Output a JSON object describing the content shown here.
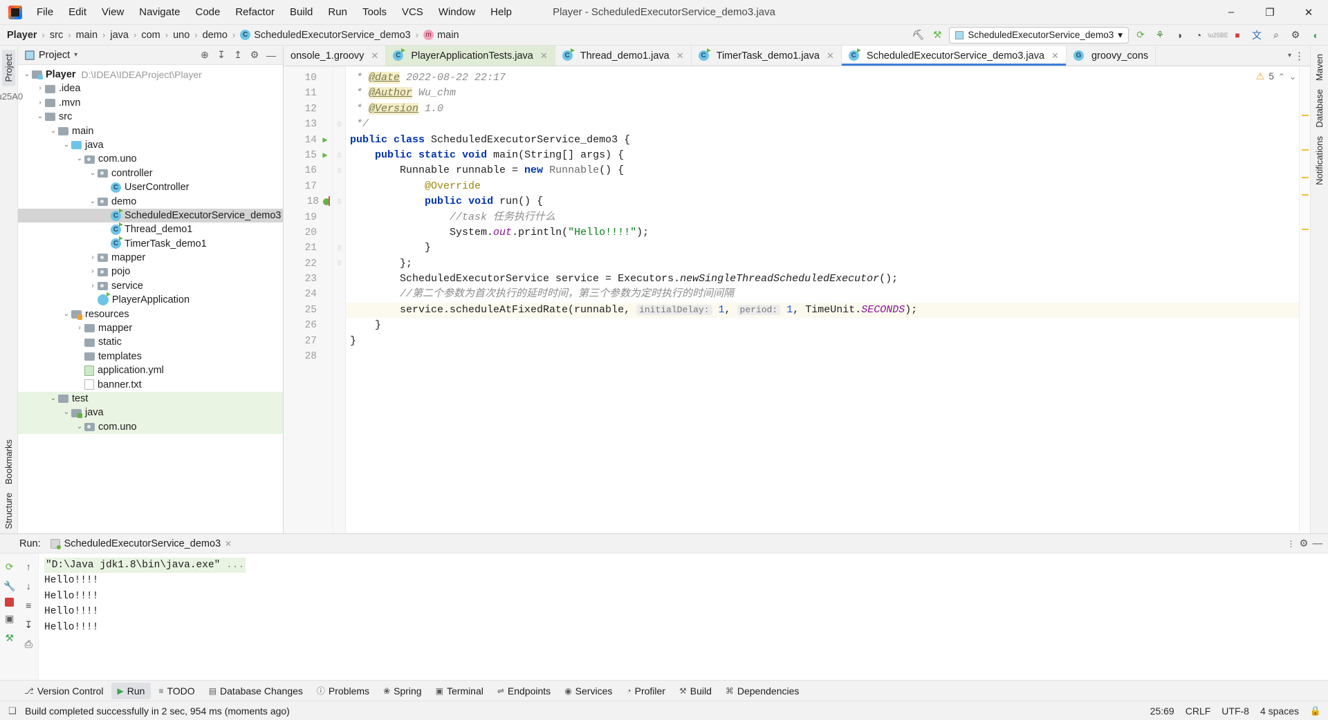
{
  "window": {
    "title": "Player - ScheduledExecutorService_demo3.java",
    "minimize": "–",
    "maximize": "❐",
    "close": "✕"
  },
  "menubar": {
    "items": [
      "File",
      "Edit",
      "View",
      "Navigate",
      "Code",
      "Refactor",
      "Build",
      "Run",
      "Tools",
      "VCS",
      "Window",
      "Help"
    ]
  },
  "breadcrumb": {
    "items": [
      {
        "label": "Player",
        "icon": "",
        "bold": true
      },
      {
        "label": "src",
        "icon": "",
        "bold": false
      },
      {
        "label": "main",
        "icon": "",
        "bold": false
      },
      {
        "label": "java",
        "icon": "",
        "bold": false
      },
      {
        "label": "com",
        "icon": "",
        "bold": false
      },
      {
        "label": "uno",
        "icon": "",
        "bold": false
      },
      {
        "label": "demo",
        "icon": "",
        "bold": false
      },
      {
        "label": "ScheduledExecutorService_demo3",
        "icon": "class-icon",
        "bold": false
      },
      {
        "label": "main",
        "icon": "method-icon",
        "bold": false
      }
    ],
    "separator": "›"
  },
  "navtoolbar": {
    "run_config_label": "ScheduledExecutorService_demo3",
    "run_config_caret": "▾",
    "icons": [
      {
        "name": "user-settings-icon",
        "glyph": "⛏"
      },
      {
        "name": "build-hammer-icon",
        "glyph": "⚒"
      },
      {
        "name": "run-icon",
        "glyph": "⟳"
      },
      {
        "name": "debug-icon",
        "glyph": "⚘"
      },
      {
        "name": "run-with-coverage-icon",
        "glyph": "◑"
      },
      {
        "name": "profiler-icon",
        "glyph": "◔"
      },
      {
        "name": "stop-icon",
        "glyph": "■"
      },
      {
        "name": "translate-icon",
        "glyph": "文"
      },
      {
        "name": "search-everywhere-icon",
        "glyph": "⌕"
      },
      {
        "name": "settings-gear-icon",
        "glyph": "⚙"
      },
      {
        "name": "ide-eval-icon",
        "glyph": "◖"
      }
    ]
  },
  "left_strip": {
    "tabs": [
      "Project"
    ],
    "bottom_tabs": [
      "Bookmarks",
      "Structure"
    ],
    "icons": [
      "rerun-icon",
      "wrench-icon",
      "stop-icon",
      "camera-icon",
      "plugin-icon",
      "expand-icon"
    ]
  },
  "right_strip": {
    "tabs": [
      "Maven",
      "Database",
      "Notifications"
    ]
  },
  "project_panel": {
    "title": "Project",
    "caret": "▾",
    "tools": [
      {
        "name": "select-opened-file-icon",
        "glyph": "⊕"
      },
      {
        "name": "expand-all-icon",
        "glyph": "↧"
      },
      {
        "name": "collapse-all-icon",
        "glyph": "↥"
      },
      {
        "name": "settings-gear-icon",
        "glyph": "⚙"
      },
      {
        "name": "hide-icon",
        "glyph": "—"
      }
    ],
    "tree": [
      {
        "label": "Player",
        "path": "D:\\IDEA\\IDEAProject\\Player",
        "depth": 0,
        "arrow": "v",
        "icon": "folder-src",
        "bold": true,
        "selected": false
      },
      {
        "label": ".idea",
        "path": "",
        "depth": 1,
        "arrow": ">",
        "icon": "folder",
        "bold": false,
        "selected": false
      },
      {
        "label": ".mvn",
        "path": "",
        "depth": 1,
        "arrow": ">",
        "icon": "folder",
        "bold": false,
        "selected": false
      },
      {
        "label": "src",
        "path": "",
        "depth": 1,
        "arrow": "v",
        "icon": "folder",
        "bold": false,
        "selected": false
      },
      {
        "label": "main",
        "path": "",
        "depth": 2,
        "arrow": "v",
        "icon": "folder",
        "bold": false,
        "selected": false
      },
      {
        "label": "java",
        "path": "",
        "depth": 3,
        "arrow": "v",
        "icon": "folder-blue",
        "bold": false,
        "selected": false
      },
      {
        "label": "com.uno",
        "path": "",
        "depth": 4,
        "arrow": "v",
        "icon": "package",
        "bold": false,
        "selected": false
      },
      {
        "label": "controller",
        "path": "",
        "depth": 5,
        "arrow": "v",
        "icon": "package",
        "bold": false,
        "selected": false
      },
      {
        "label": "UserController",
        "path": "",
        "depth": 6,
        "arrow": "",
        "icon": "class",
        "bold": false,
        "selected": false
      },
      {
        "label": "demo",
        "path": "",
        "depth": 5,
        "arrow": "v",
        "icon": "package",
        "bold": false,
        "selected": false
      },
      {
        "label": "ScheduledExecutorService_demo3",
        "path": "",
        "depth": 6,
        "arrow": "",
        "icon": "class-runnable",
        "bold": false,
        "selected": true
      },
      {
        "label": "Thread_demo1",
        "path": "",
        "depth": 6,
        "arrow": "",
        "icon": "class-runnable",
        "bold": false,
        "selected": false
      },
      {
        "label": "TimerTask_demo1",
        "path": "",
        "depth": 6,
        "arrow": "",
        "icon": "class-runnable",
        "bold": false,
        "selected": false
      },
      {
        "label": "mapper",
        "path": "",
        "depth": 5,
        "arrow": ">",
        "icon": "package",
        "bold": false,
        "selected": false
      },
      {
        "label": "pojo",
        "path": "",
        "depth": 5,
        "arrow": ">",
        "icon": "package",
        "bold": false,
        "selected": false
      },
      {
        "label": "service",
        "path": "",
        "depth": 5,
        "arrow": ">",
        "icon": "package",
        "bold": false,
        "selected": false
      },
      {
        "label": "PlayerApplication",
        "path": "",
        "depth": 5,
        "arrow": "",
        "icon": "spring-class",
        "bold": false,
        "selected": false
      },
      {
        "label": "resources",
        "path": "",
        "depth": 3,
        "arrow": "v",
        "icon": "folder-res",
        "bold": false,
        "selected": false
      },
      {
        "label": "mapper",
        "path": "",
        "depth": 4,
        "arrow": ">",
        "icon": "folder",
        "bold": false,
        "selected": false
      },
      {
        "label": "static",
        "path": "",
        "depth": 4,
        "arrow": "",
        "icon": "folder",
        "bold": false,
        "selected": false
      },
      {
        "label": "templates",
        "path": "",
        "depth": 4,
        "arrow": "",
        "icon": "folder",
        "bold": false,
        "selected": false
      },
      {
        "label": "application.yml",
        "path": "",
        "depth": 4,
        "arrow": "",
        "icon": "file-yml",
        "bold": false,
        "selected": false
      },
      {
        "label": "banner.txt",
        "path": "",
        "depth": 4,
        "arrow": "",
        "icon": "file-txt",
        "bold": false,
        "selected": false
      },
      {
        "label": "test",
        "path": "",
        "depth": 2,
        "arrow": "v",
        "icon": "folder",
        "bold": false,
        "selected": false,
        "testsrc": true
      },
      {
        "label": "java",
        "path": "",
        "depth": 3,
        "arrow": "v",
        "icon": "folder-test",
        "bold": false,
        "selected": false,
        "testsrc": true
      },
      {
        "label": "com.uno",
        "path": "",
        "depth": 4,
        "arrow": "v",
        "icon": "package",
        "bold": false,
        "selected": false,
        "testsrc": true
      }
    ]
  },
  "editor_tabs": {
    "tabs": [
      {
        "label": "onsole_1.groovy",
        "icon": "",
        "state": "partial",
        "close": "✕"
      },
      {
        "label": "PlayerApplicationTests.java",
        "icon": "class-runnable",
        "state": "green",
        "close": "✕"
      },
      {
        "label": "Thread_demo1.java",
        "icon": "class-runnable",
        "state": "normal",
        "close": "✕"
      },
      {
        "label": "TimerTask_demo1.java",
        "icon": "class-runnable",
        "state": "normal",
        "close": "✕"
      },
      {
        "label": "ScheduledExecutorService_demo3.java",
        "icon": "class-runnable",
        "state": "active",
        "close": "✕"
      },
      {
        "label": "groovy_cons",
        "icon": "groovy",
        "state": "normal",
        "close": ""
      }
    ],
    "extra": [
      {
        "name": "tab-list-caret-icon",
        "glyph": "▾"
      },
      {
        "name": "tab-options-icon",
        "glyph": "⋮"
      }
    ]
  },
  "editor": {
    "warning_count": "5",
    "warning_icon": "⚠",
    "up_caret": "⌃",
    "down_caret": "⌄",
    "first_line": 10,
    "lines": [
      {
        "n": 10,
        "run": false,
        "fold": "",
        "current": false
      },
      {
        "n": 11,
        "run": false,
        "fold": "",
        "current": false
      },
      {
        "n": 12,
        "run": false,
        "fold": "",
        "current": false
      },
      {
        "n": 13,
        "run": false,
        "fold": "end",
        "current": false
      },
      {
        "n": 14,
        "run": true,
        "fold": "",
        "current": false
      },
      {
        "n": 15,
        "run": true,
        "fold": "start",
        "current": false
      },
      {
        "n": 16,
        "run": false,
        "fold": "start",
        "current": false
      },
      {
        "n": 17,
        "run": false,
        "fold": "",
        "current": false
      },
      {
        "n": 18,
        "run": false,
        "fold": "start",
        "current": false,
        "breakpoint": true
      },
      {
        "n": 19,
        "run": false,
        "fold": "",
        "current": false
      },
      {
        "n": 20,
        "run": false,
        "fold": "",
        "current": false
      },
      {
        "n": 21,
        "run": false,
        "fold": "end",
        "current": false
      },
      {
        "n": 22,
        "run": false,
        "fold": "end",
        "current": false
      },
      {
        "n": 23,
        "run": false,
        "fold": "",
        "current": false
      },
      {
        "n": 24,
        "run": false,
        "fold": "",
        "current": false
      },
      {
        "n": 25,
        "run": false,
        "fold": "",
        "current": true
      },
      {
        "n": 26,
        "run": false,
        "fold": "",
        "current": false
      },
      {
        "n": 27,
        "run": false,
        "fold": "",
        "current": false
      },
      {
        "n": 28,
        "run": false,
        "fold": "",
        "current": false
      }
    ],
    "code_text": {
      "l10": " * @date 2022-08-22 22:17",
      "l11": " * @Author Wu_chm",
      "l12": " * @Version 1.0",
      "l13": " */",
      "l14": "public class ScheduledExecutorService_demo3 {",
      "l15": "    public static void main(String[] args) {",
      "l16": "        Runnable runnable = new Runnable() {",
      "l17": "            @Override",
      "l18": "            public void run() {",
      "l19": "                //task 任务执行什么",
      "l20": "                System.out.println(\"Hello!!!!\");",
      "l21": "            }",
      "l22": "        };",
      "l23": "        ScheduledExecutorService service = Executors.newSingleThreadScheduledExecutor();",
      "l24": "        //第二个参数为首次执行的延时时间，第三个参数为定时执行的时间间隔",
      "l25": "        service.scheduleAtFixedRate(runnable, initialDelay: 1, period: 1, TimeUnit.SECONDS);",
      "l26": "    }",
      "l27": "}",
      "l28": ""
    },
    "inlay_hints": [
      "initialDelay:",
      "period:"
    ]
  },
  "run_window": {
    "label": "Run:",
    "tab_title": "ScheduledExecutorService_demo3",
    "tab_close": "✕",
    "settings_icon": "⚙",
    "hide_icon": "—",
    "more_icon": "⋮",
    "sidebar_icons": [
      {
        "name": "rerun-icon",
        "glyph": "⟳"
      },
      {
        "name": "wrench-settings-icon",
        "glyph": "ὒ7"
      },
      {
        "name": "stop-icon",
        "glyph": "■"
      },
      {
        "name": "camera-icon",
        "glyph": "▣"
      },
      {
        "name": "pin-icon",
        "glyph": "⚑"
      },
      {
        "name": "scroll-up-icon",
        "glyph": "↑"
      },
      {
        "name": "scroll-down-icon",
        "glyph": "↓"
      },
      {
        "name": "soft-wrap-icon",
        "glyph": "≡"
      },
      {
        "name": "scroll-end-icon",
        "glyph": "↧"
      },
      {
        "name": "print-icon",
        "glyph": "⎙"
      }
    ],
    "console": [
      {
        "text": "\"D:\\Java jdk1.8\\bin\\java.exe\"",
        "suffix": " ...",
        "cmd": true
      },
      {
        "text": "Hello!!!!",
        "suffix": "",
        "cmd": false
      },
      {
        "text": "Hello!!!!",
        "suffix": "",
        "cmd": false
      },
      {
        "text": "Hello!!!!",
        "suffix": "",
        "cmd": false
      },
      {
        "text": "Hello!!!!",
        "suffix": "",
        "cmd": false
      }
    ]
  },
  "bottom_bar": {
    "items": [
      {
        "label": "Version Control",
        "icon": "⎇",
        "active": false
      },
      {
        "label": "Run",
        "icon": "▶",
        "active": true
      },
      {
        "label": "TODO",
        "icon": "≡",
        "active": false
      },
      {
        "label": "Database Changes",
        "icon": "▤",
        "active": false
      },
      {
        "label": "Problems",
        "icon": "ⓘ",
        "active": false
      },
      {
        "label": "Spring",
        "icon": "❀",
        "active": false
      },
      {
        "label": "Terminal",
        "icon": "▣",
        "active": false
      },
      {
        "label": "Endpoints",
        "icon": "⇌",
        "active": false
      },
      {
        "label": "Services",
        "icon": "◉",
        "active": false
      },
      {
        "label": "Profiler",
        "icon": "◔",
        "active": false
      },
      {
        "label": "Build",
        "icon": "⚒",
        "active": false
      },
      {
        "label": "Dependencies",
        "icon": "⌘",
        "active": false
      }
    ]
  },
  "status_bar": {
    "icon": "❑",
    "message": "Build completed successfully in 2 sec, 954 ms (moments ago)",
    "caret_position": "25:69",
    "line_separator": "CRLF",
    "encoding": "UTF-8",
    "indent": "4 spaces",
    "lock_icon": "ὑ2"
  },
  "colors": {
    "accent_blue": "#3c7ddb",
    "keyword": "#0033b3",
    "string": "#067d17",
    "number": "#1750eb",
    "comment": "#8c8c8c",
    "annotation": "#9e880d",
    "static_field": "#871094",
    "selection": "#d4d4d4",
    "test_source": "#e9f4e2"
  }
}
